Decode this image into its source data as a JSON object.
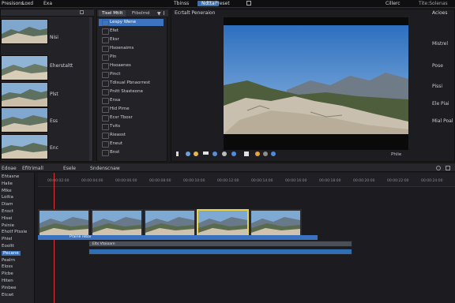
{
  "menubar": {
    "items": [
      "Presisons",
      "Loxd",
      "Exa",
      "Tbinss",
      "Ndtta",
      "Preset"
    ],
    "active_index": 4,
    "right_items": [
      "Cillerc",
      "Tite:Solenas"
    ]
  },
  "media_panel": {
    "thumb_labels": [
      "Nisi",
      "Eherstaltt",
      "Plst",
      "Ess",
      "Enc"
    ]
  },
  "browser_panel": {
    "tabs": [
      "Tisel Mtilt",
      "Ftbolmd"
    ],
    "rows": [
      "Lespy Wene",
      "Efet",
      "Eksr",
      "Hsoenaims",
      "Pln",
      "Hsoaenes",
      "Pinct",
      "Tdisual Pbnaorrest",
      "Pnitt Stasteone",
      "Ensa",
      "Hid Pirne",
      "Ecsr Tbosr",
      "Tvits",
      "Rieasst",
      "Eneut",
      "Bnst"
    ],
    "selected_index": 0
  },
  "viewer": {
    "title": "Ecrtalt Peneraion",
    "right_label": "Acioes",
    "side_labels": [
      "Mistrel",
      "Pose",
      "Pissi",
      "Ele Piai",
      "Mial Poal"
    ],
    "timecode": "Phlie"
  },
  "left_toolbar": {
    "labels": [
      "Edoae",
      "Efitrimall",
      "Esele",
      "Sndenscnaw"
    ]
  },
  "timeline": {
    "ruler_ticks": [
      "00:00:02:00",
      "00:00:04:00",
      "00:00:06:00",
      "00:00:08:00",
      "00:00:10:00",
      "00:00:12:00",
      "00:00:14:00",
      "00:00:16:00",
      "00:00:18:00",
      "00:00:20:00",
      "00:00:22:00",
      "00:00:24:00"
    ],
    "track_labels": [
      "Ehtasne",
      "Halie",
      "Mlke",
      "Loitia",
      "Diam",
      "Ensct",
      "Hisei",
      "Psinie",
      "Ehotf Ptssie",
      "Phiel",
      "Eooltt",
      "Pecane",
      "Pealrn",
      "Eloss",
      "Plcbe",
      "Hiten",
      "Pinbee",
      "Etcwt"
    ],
    "selected_label_index": 11,
    "clip_strip_label": "Prairie rebar",
    "selected_clip_index": 3,
    "bar_label": "Elts Vtoioarn"
  }
}
